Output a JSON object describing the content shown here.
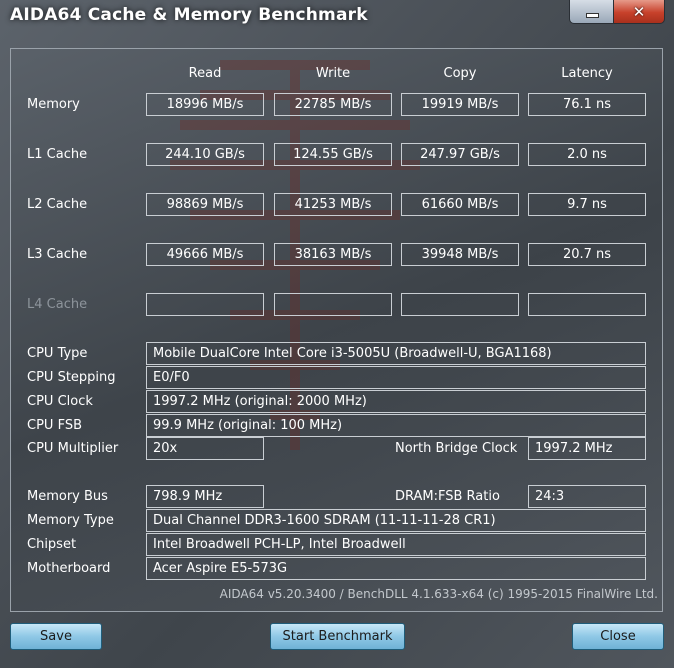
{
  "window": {
    "title": "AIDA64 Cache & Memory Benchmark",
    "minimize_icon": "minimize-icon",
    "close_icon": "close-icon",
    "close_glyph": "✕"
  },
  "headers": {
    "read": "Read",
    "write": "Write",
    "copy": "Copy",
    "latency": "Latency"
  },
  "bench_rows": [
    {
      "label": "Memory",
      "read": "18996 MB/s",
      "write": "22785 MB/s",
      "copy": "19919 MB/s",
      "latency": "76.1 ns"
    },
    {
      "label": "L1 Cache",
      "read": "244.10 GB/s",
      "write": "124.55 GB/s",
      "copy": "247.97 GB/s",
      "latency": "2.0 ns"
    },
    {
      "label": "L2 Cache",
      "read": "98869 MB/s",
      "write": "41253 MB/s",
      "copy": "61660 MB/s",
      "latency": "9.7 ns"
    },
    {
      "label": "L3 Cache",
      "read": "49666 MB/s",
      "write": "38163 MB/s",
      "copy": "39948 MB/s",
      "latency": "20.7 ns"
    },
    {
      "label": "L4 Cache",
      "read": "",
      "write": "",
      "copy": "",
      "latency": ""
    }
  ],
  "cpu": {
    "type_label": "CPU Type",
    "type_value": "Mobile DualCore Intel Core i3-5005U  (Broadwell-U, BGA1168)",
    "stepping_label": "CPU Stepping",
    "stepping_value": "E0/F0",
    "clock_label": "CPU Clock",
    "clock_value": "1997.2 MHz  (original: 2000 MHz)",
    "fsb_label": "CPU FSB",
    "fsb_value": "99.9 MHz  (original: 100 MHz)",
    "multiplier_label": "CPU Multiplier",
    "multiplier_value": "20x",
    "nb_clock_label": "North Bridge Clock",
    "nb_clock_value": "1997.2 MHz"
  },
  "memory": {
    "bus_label": "Memory Bus",
    "bus_value": "798.9 MHz",
    "ratio_label": "DRAM:FSB Ratio",
    "ratio_value": "24:3",
    "type_label": "Memory Type",
    "type_value": "Dual Channel DDR3-1600 SDRAM  (11-11-11-28 CR1)",
    "chipset_label": "Chipset",
    "chipset_value": "Intel Broadwell PCH-LP, Intel Broadwell",
    "motherboard_label": "Motherboard",
    "motherboard_value": "Acer Aspire E5-573G"
  },
  "footer": "AIDA64 v5.20.3400 / BenchDLL 4.1.633-x64  (c) 1995-2015 FinalWire Ltd.",
  "buttons": {
    "save": "Save",
    "start": "Start Benchmark",
    "close": "Close"
  },
  "colors": {
    "button_gradient_top": "#c8e7f7",
    "button_gradient_bottom": "#6fb2d6",
    "close_button": "#c7412b"
  }
}
